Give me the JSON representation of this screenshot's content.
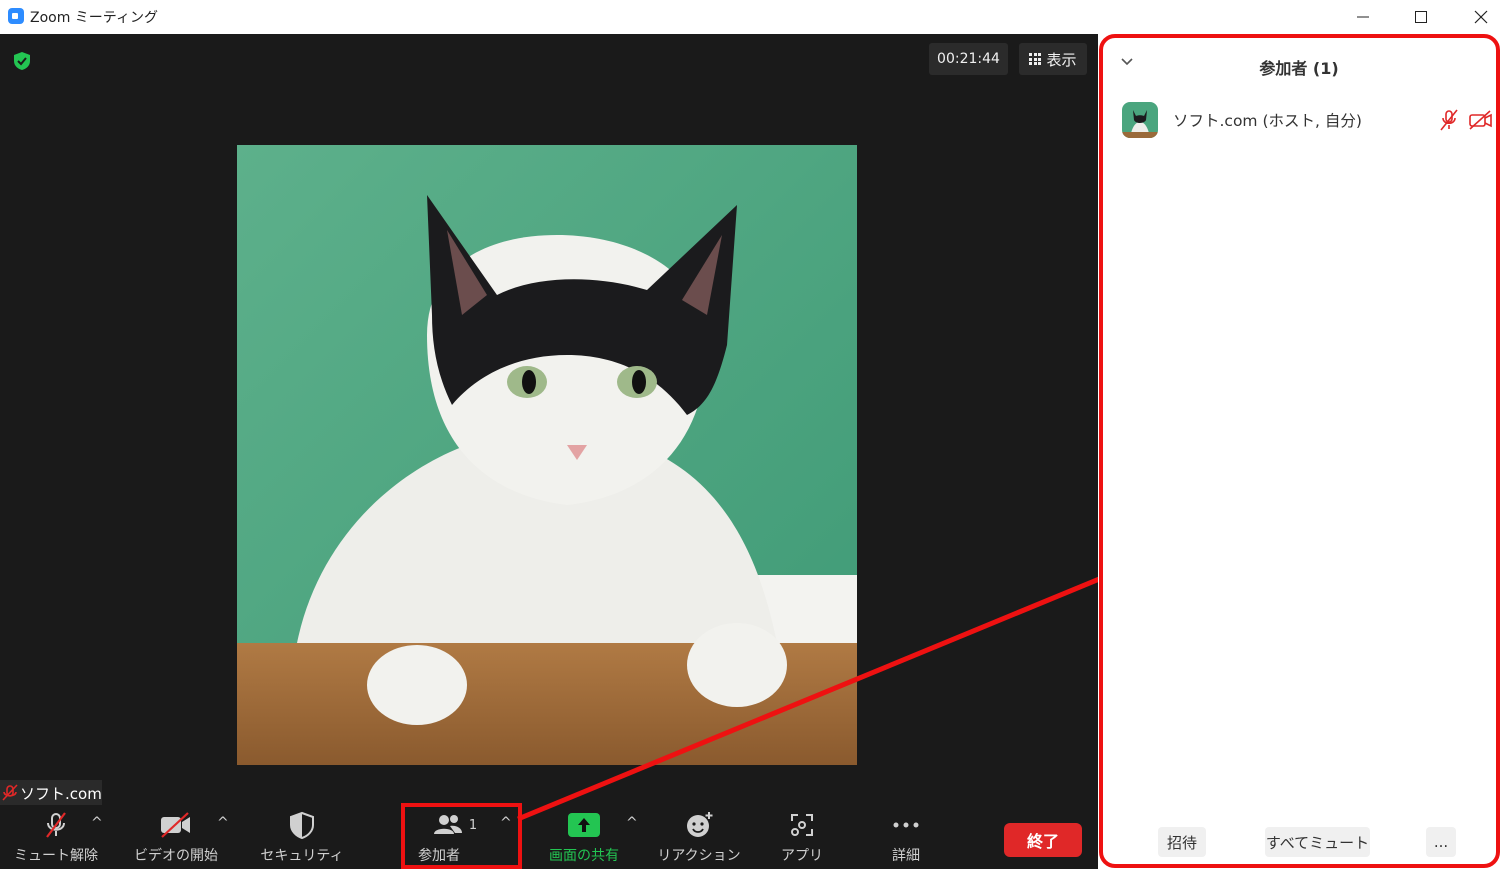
{
  "window": {
    "title": "Zoom ミーティング",
    "minimize_icon": "minimize-icon",
    "maximize_icon": "maximize-icon",
    "close_icon": "close-icon"
  },
  "meeting": {
    "timer": "00:21:44",
    "view_label": "表示",
    "security_badge_color": "#23C552",
    "participant_name_tag": "ソフト.com"
  },
  "toolbar": {
    "unmute_label": "ミュート解除",
    "video_start_label": "ビデオの開始",
    "security_label": "セキュリティ",
    "participants_label": "参加者",
    "participants_count": "1",
    "share_screen_label": "画面の共有",
    "reactions_label": "リアクション",
    "apps_label": "アプリ",
    "more_label": "詳細",
    "end_label": "終了",
    "caret": "^"
  },
  "panel": {
    "title": "参加者 (1)",
    "participants": [
      {
        "name": "ソフト.com (ホスト, 自分)",
        "mic_icon": "mic-muted-icon",
        "video_icon": "video-off-icon"
      }
    ],
    "invite_label": "招待",
    "mute_all_label": "すべてミュート",
    "more_label": "..."
  },
  "colors": {
    "accent_green": "#23C552",
    "end_red": "#E02828",
    "annotation_red": "#EE1111",
    "muted_red": "#E02828"
  }
}
